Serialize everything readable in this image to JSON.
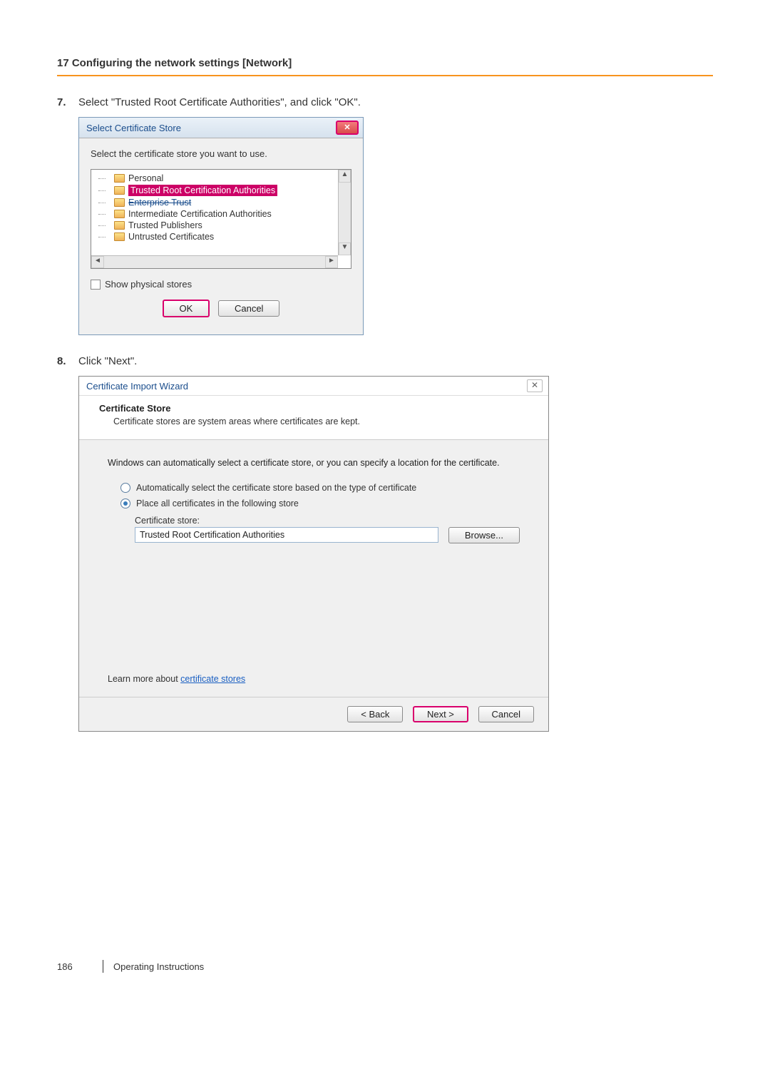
{
  "header": {
    "section_title": "17 Configuring the network settings [Network]"
  },
  "steps": [
    {
      "num": "7.",
      "text": "Select \"Trusted Root Certificate Authorities\", and click \"OK\"."
    },
    {
      "num": "8.",
      "text": "Click \"Next\"."
    }
  ],
  "dlg1": {
    "title": "Select Certificate Store",
    "instruction": "Select the certificate store you want to use.",
    "tree_items": [
      {
        "label": "Personal"
      },
      {
        "label": "Trusted Root Certification Authorities"
      },
      {
        "label": "Enterprise Trust"
      },
      {
        "label": "Intermediate Certification Authorities"
      },
      {
        "label": "Trusted Publishers"
      },
      {
        "label": "Untrusted Certificates"
      }
    ],
    "show_physical_label": "Show physical stores",
    "ok_label": "OK",
    "cancel_label": "Cancel"
  },
  "dlg2": {
    "title": "Certificate Import Wizard",
    "section_title": "Certificate Store",
    "section_sub": "Certificate stores are system areas where certificates are kept.",
    "desc": "Windows can automatically select a certificate store, or you can specify a location for the certificate.",
    "radio_auto": "Automatically select the certificate store based on the type of certificate",
    "radio_place": "Place all certificates in the following store",
    "cert_store_label": "Certificate store:",
    "cert_store_value": "Trusted Root Certification Authorities",
    "browse_label": "Browse...",
    "learn_prefix": "Learn more about ",
    "learn_link": "certificate stores",
    "back_label": "< Back",
    "next_label": "Next >",
    "cancel_label": "Cancel"
  },
  "footer": {
    "page_number": "186",
    "doc_title": "Operating Instructions"
  }
}
